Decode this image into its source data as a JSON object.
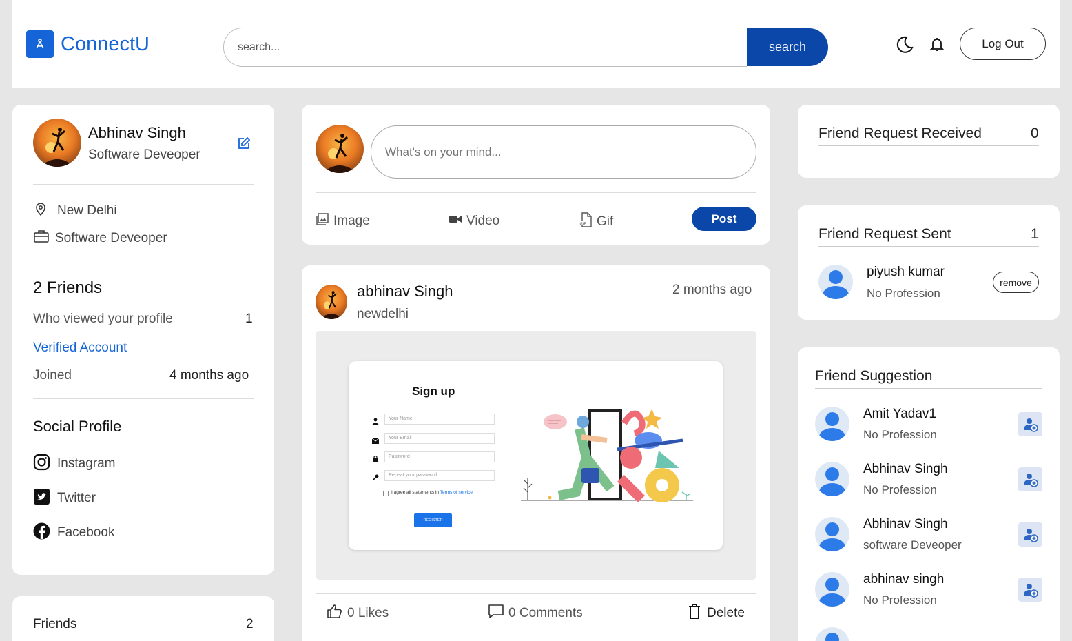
{
  "app": {
    "name": "ConnectU"
  },
  "header": {
    "search_placeholder": "search...",
    "search_button": "search",
    "logout_label": "Log Out"
  },
  "profile": {
    "name": "Abhinav Singh",
    "title": "Software Deveoper",
    "location": "New Delhi",
    "occupation": "Software Deveoper",
    "friends_label": "2 Friends",
    "viewed_label": "Who viewed your profile",
    "viewed_count": "1",
    "verified_label": "Verified Account",
    "joined_label": "Joined",
    "joined_value": "4 months ago",
    "social_title": "Social Profile",
    "social": [
      "Instagram",
      "Twitter",
      "Facebook"
    ]
  },
  "friends_card": {
    "label": "Friends",
    "count": "2"
  },
  "compose": {
    "placeholder": "What's on your mind...",
    "image": "Image",
    "video": "Video",
    "gif": "Gif",
    "post": "Post"
  },
  "post": {
    "author": "abhinav Singh",
    "location": "newdelhi",
    "time": "2 months ago",
    "image": {
      "title": "Sign up",
      "fields": [
        "Your Name",
        "Your Email",
        "Password",
        "Repeat your password"
      ],
      "agree": "I agree all statements in",
      "terms": "Terms of service",
      "register": "REGISTER"
    },
    "likes": "0 Likes",
    "comments": "0 Comments",
    "delete": "Delete"
  },
  "requests_received": {
    "label": "Friend Request Received",
    "count": "0"
  },
  "requests_sent": {
    "label": "Friend Request Sent",
    "count": "1",
    "items": [
      {
        "name": "piyush kumar",
        "profession": "No Profession",
        "action": "remove"
      }
    ]
  },
  "suggestions": {
    "label": "Friend Suggestion",
    "items": [
      {
        "name": "Amit Yadav1",
        "profession": "No Profession"
      },
      {
        "name": "Abhinav Singh",
        "profession": "No Profession"
      },
      {
        "name": "Abhinav Singh",
        "profession": "software Deveoper"
      },
      {
        "name": "abhinav singh",
        "profession": "No Profession"
      }
    ]
  },
  "colors": {
    "brand": "#1565d8",
    "primary_button": "#0b47a8",
    "background": "#e6e6e6"
  }
}
